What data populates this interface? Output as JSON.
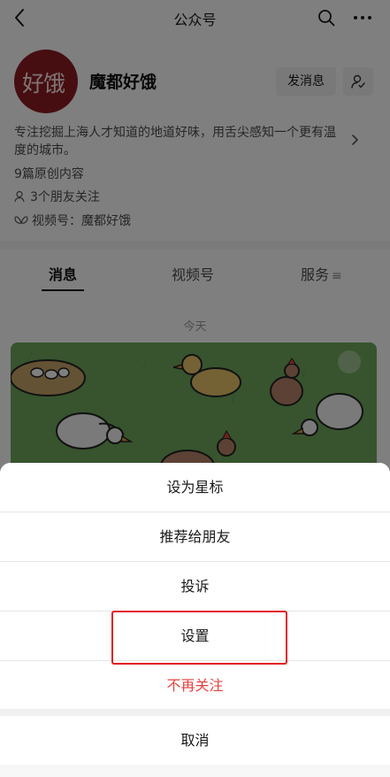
{
  "navbar": {
    "title": "公众号"
  },
  "profile": {
    "avatar_text": "好饿",
    "name": "魔都好饿",
    "message_button": "发消息",
    "intro": "专注挖掘上海人才知道的地道好味，用舌尖感知一个更有温度的城市。",
    "original_count": "9篇原创内容",
    "friends_following": "3个朋友关注",
    "channels": "视频号：魔都好饿"
  },
  "tabs": [
    {
      "label": "消息",
      "active": true
    },
    {
      "label": "视频号",
      "active": false
    },
    {
      "label": "服务",
      "active": false
    }
  ],
  "feed": {
    "date_label": "今天"
  },
  "action_sheet": {
    "items": [
      {
        "label": "设为星标"
      },
      {
        "label": "推荐给朋友"
      },
      {
        "label": "投诉"
      },
      {
        "label": "设置"
      },
      {
        "label": "不再关注"
      }
    ],
    "cancel": "取消"
  },
  "colors": {
    "danger": "#e64340",
    "highlight": "#e21d24",
    "avatar_bg": "#8c1c23"
  }
}
